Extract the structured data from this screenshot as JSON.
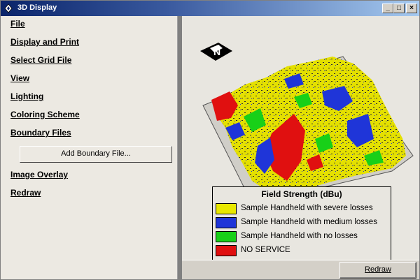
{
  "window": {
    "title": "3D Display"
  },
  "titlebar_buttons": {
    "minimize": "_",
    "maximize": "□",
    "close": "×"
  },
  "menu": {
    "items": [
      {
        "label": "File"
      },
      {
        "label": "Display and Print"
      },
      {
        "label": "Select Grid File"
      },
      {
        "label": "View"
      },
      {
        "label": "Lighting"
      },
      {
        "label": "Coloring Scheme"
      },
      {
        "label": "Boundary Files"
      }
    ],
    "add_boundary_label": "Add Boundary File...",
    "items_after": [
      {
        "label": "Image Overlay"
      },
      {
        "label": "Redraw"
      }
    ]
  },
  "compass": {
    "label": "N"
  },
  "legend": {
    "title": "Field Strength (dBu)",
    "entries": [
      {
        "label": "Sample Handheld with severe losses",
        "color": "#e8e800"
      },
      {
        "label": "Sample Handheld with medium losses",
        "color": "#1f35d8"
      },
      {
        "label": "Sample Handheld with no losses",
        "color": "#18d018"
      },
      {
        "label": "NO SERVICE",
        "color": "#e01010"
      }
    ]
  },
  "footer": {
    "redraw_label": "Redraw"
  }
}
